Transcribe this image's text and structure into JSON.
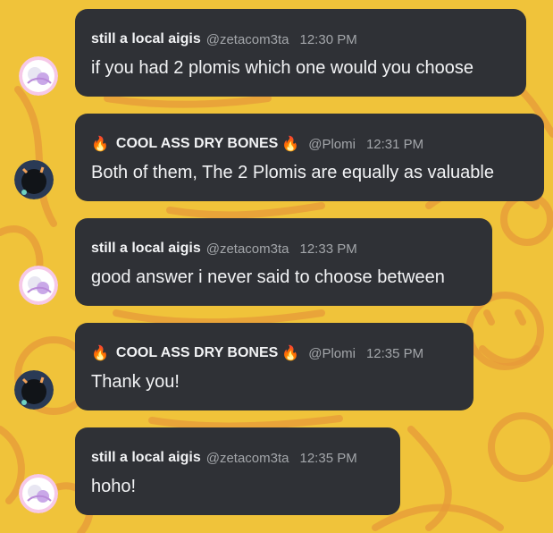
{
  "messages": [
    {
      "name": "still a local aigis",
      "handle": "@zetacom3ta",
      "time": "12:30 PM",
      "text": "if you had 2 plomis which one would you choose",
      "fire": false
    },
    {
      "name": "COOL ASS DRY BONES",
      "handle": "@Plomi",
      "time": "12:31 PM",
      "text": "Both of them, The 2 Plomis are equally as valuable",
      "fire": true
    },
    {
      "name": "still a local aigis",
      "handle": "@zetacom3ta",
      "time": "12:33 PM",
      "text": "good answer i never said to choose between",
      "fire": false
    },
    {
      "name": "COOL ASS DRY BONES",
      "handle": "@Plomi",
      "time": "12:35 PM",
      "text": "Thank you!",
      "fire": true
    },
    {
      "name": "still a local aigis",
      "handle": "@zetacom3ta",
      "time": "12:35 PM",
      "text": "hoho!",
      "fire": false
    }
  ],
  "fire_emoji": "🔥",
  "colors": {
    "background": "#f0c33a",
    "pattern": "#e79a3a",
    "bubble": "#2f3136",
    "name": "#f2f3f5",
    "meta": "#a3a6aa"
  }
}
